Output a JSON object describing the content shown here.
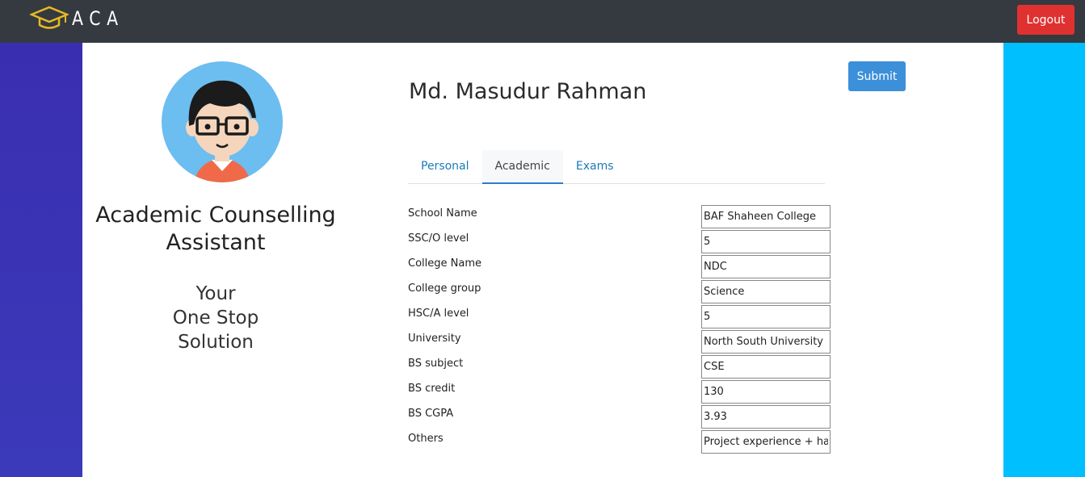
{
  "navbar": {
    "brand_text": "ACA",
    "brand_icon": "graduation-cap-icon",
    "logout_label": "Logout"
  },
  "sidebar": {
    "avatar_icon": "user-avatar",
    "app_title": "Academic Counselling Assistant",
    "tagline_lines": [
      "Your",
      "One Stop",
      "Solution"
    ]
  },
  "profile": {
    "name": "Md. Masudur Rahman",
    "submit_label": "Submit"
  },
  "tabs": [
    {
      "label": "Personal",
      "active": false
    },
    {
      "label": "Academic",
      "active": true
    },
    {
      "label": "Exams",
      "active": false
    }
  ],
  "fields": [
    {
      "label": "School Name",
      "value": "BAF Shaheen College"
    },
    {
      "label": "SSC/O level",
      "value": "5"
    },
    {
      "label": "College Name",
      "value": "NDC"
    },
    {
      "label": "College group",
      "value": "Science"
    },
    {
      "label": "HSC/A level",
      "value": "5"
    },
    {
      "label": "University",
      "value": "North South University"
    },
    {
      "label": "BS subject",
      "value": "CSE"
    },
    {
      "label": "BS credit",
      "value": "130"
    },
    {
      "label": "BS CGPA",
      "value": "3.93"
    },
    {
      "label": "Others",
      "value": "Project experience + hav"
    }
  ],
  "colors": {
    "navbar": "#343a40",
    "logout": "#e03131",
    "submit": "#3c8fd9",
    "left_stripe": "#3a2eb0",
    "right_stripe": "#00bfff"
  }
}
